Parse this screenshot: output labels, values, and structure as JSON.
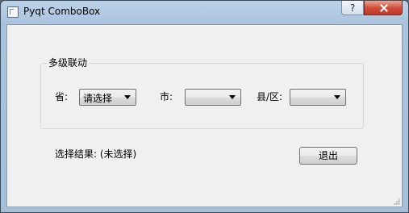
{
  "window": {
    "title": "Pyqt ComboBox",
    "help_glyph": "?"
  },
  "group": {
    "title": "多级联动",
    "province_label": "省:",
    "province_value": "请选择",
    "city_label": "市:",
    "city_value": "",
    "county_label": "县/区:",
    "county_value": ""
  },
  "result": {
    "text": "选择结果: (未选择)"
  },
  "buttons": {
    "exit_label": "退出"
  },
  "icons": {
    "app": "window-icon",
    "help": "help-icon",
    "close": "close-icon",
    "dropdown": "chevron-down-icon",
    "grip": "resize-grip-icon"
  },
  "colors": {
    "client_bg": "#f0f0f0",
    "titlebar": "#bcd2e8",
    "close_red": "#c0392b"
  }
}
